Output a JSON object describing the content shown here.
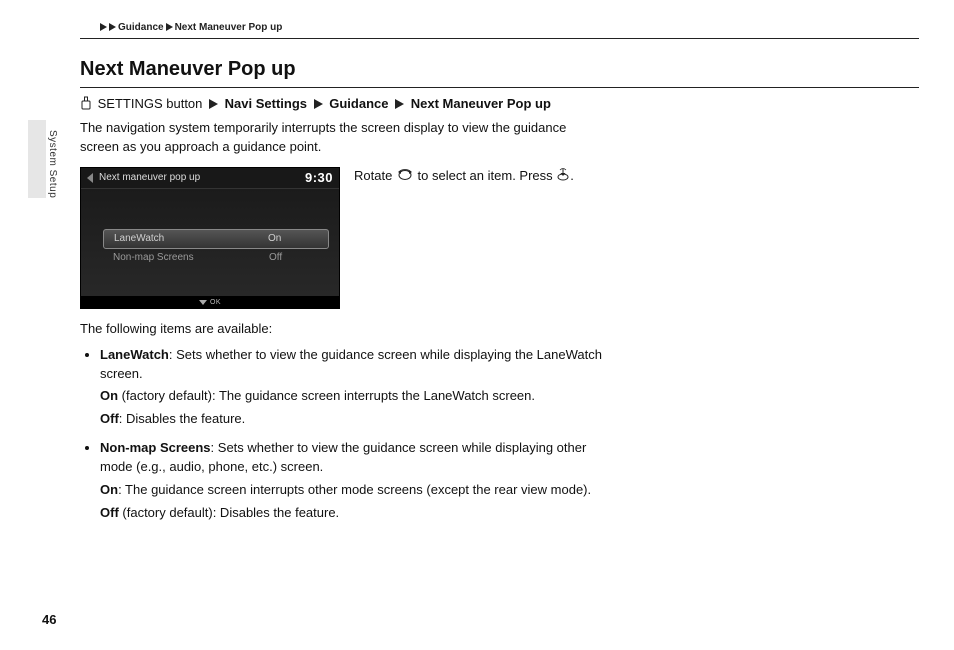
{
  "breadcrumb": {
    "section": "Guidance",
    "page": "Next Maneuver Pop up"
  },
  "side_tab": "System Setup",
  "title": "Next Maneuver Pop up",
  "path": {
    "start": "SETTINGS button",
    "step1": "Navi Settings",
    "step2": "Guidance",
    "step3": "Next Maneuver Pop up"
  },
  "intro": "The navigation system temporarily interrupts the screen display to view the guidance screen as you approach a guidance point.",
  "screenshot": {
    "title": "Next maneuver pop up",
    "time": "9:30",
    "rows": [
      {
        "label": "LaneWatch",
        "value": "On"
      },
      {
        "label": "Non-map Screens",
        "value": "Off"
      }
    ],
    "ok": "OK"
  },
  "rotate_line": {
    "part1": "Rotate ",
    "part2": " to select an item. Press ",
    "part3": "."
  },
  "available_intro": "The following items are available:",
  "items": {
    "lane": {
      "name": "LaneWatch",
      "desc": ": Sets whether to view the guidance screen while displaying the LaneWatch screen.",
      "on_label": "On",
      "on_desc": " (factory default): The guidance screen interrupts the LaneWatch screen.",
      "off_label": "Off",
      "off_desc": ": Disables the feature."
    },
    "nonmap": {
      "name": "Non-map Screens",
      "desc": ": Sets whether to view the guidance screen while displaying other mode (e.g., audio, phone, etc.) screen.",
      "on_label": "On",
      "on_desc": ": The guidance screen interrupts other mode screens (except the rear view mode).",
      "off_label": "Off",
      "off_desc": " (factory default): Disables the feature."
    }
  },
  "page_number": "46"
}
